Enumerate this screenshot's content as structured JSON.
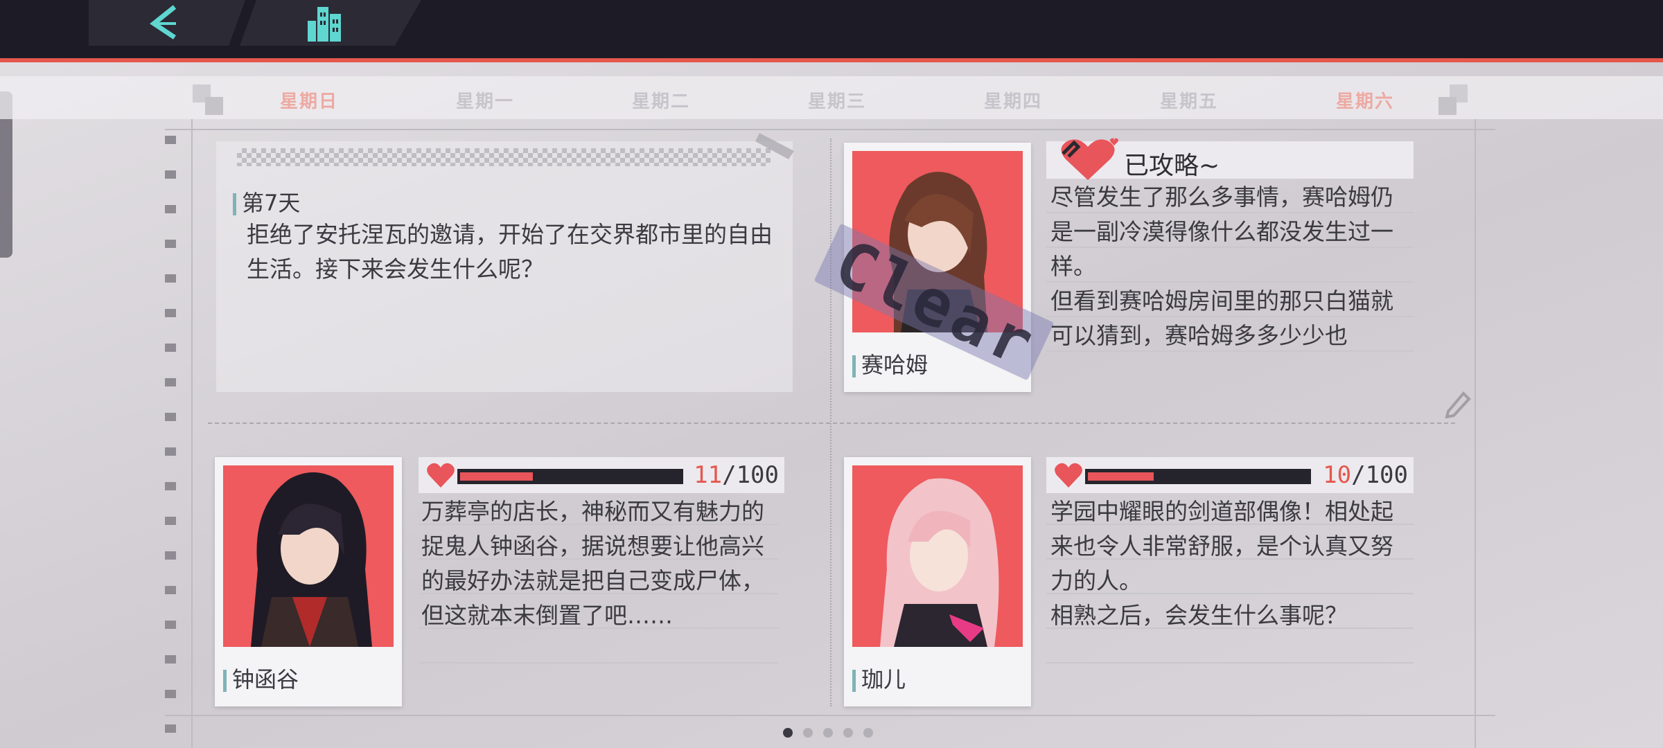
{
  "nav": {
    "back_icon": "chevron-left-icon",
    "home_icon": "city-buildings-icon"
  },
  "weekdays": [
    "星期日",
    "星期一",
    "星期二",
    "星期三",
    "星期四",
    "星期五",
    "星期六"
  ],
  "note": {
    "day_label": "第7天",
    "text": "拒绝了安托涅瓦的邀请，开始了在交界都市里的自由生活。接下来会发生什么呢？"
  },
  "characters": [
    {
      "name": "赛哈姆",
      "status_label": "已攻略~",
      "stamp": "Clear",
      "description": "尽管发生了那么多事情，赛哈姆仍是一副冷漠得像什么都没发生过一样。\n但看到赛哈姆房间里的那只白猫就可以猜到，赛哈姆多多少少也"
    },
    {
      "name": "钟函谷",
      "affection_current": "11",
      "affection_max": "/100",
      "affection_value": 11,
      "description": "万葬亭的店长，神秘而又有魅力的捉鬼人钟函谷，据说想要让他高兴的最好办法就是把自己变成尸体，但这就本末倒置了吧……"
    },
    {
      "name": "珈儿",
      "affection_current": "10",
      "affection_max": "/100",
      "affection_value": 10,
      "description": "学园中耀眼的剑道部偶像！相处起来也令人非常舒服，是个认真又努力的人。\n相熟之后，会发生什么事呢？"
    }
  ],
  "pager": {
    "pages": 5,
    "current": 1
  },
  "colors": {
    "accent_red": "#e5574d",
    "heart": "#e8555a",
    "portrait_bg": "#ee5a5d",
    "accent_teal": "#7fb3b6"
  }
}
